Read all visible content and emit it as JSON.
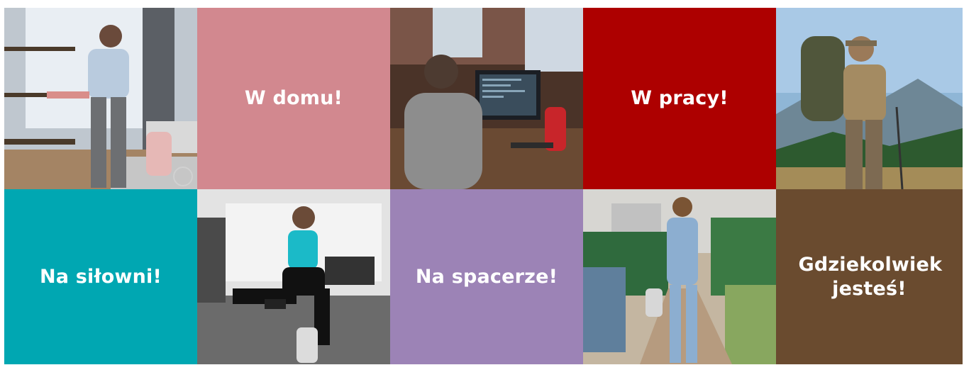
{
  "tiles": {
    "home_label": "W domu!",
    "work_label": "W pracy!",
    "gym_label": "Na siłowni!",
    "walk_label": "Na spacerze!",
    "anywhere_label_line1": "Gdziekolwiek",
    "anywhere_label_line2": "jesteś!"
  },
  "photos": {
    "home_scene": "woman-cleaning-home-with-bottle",
    "office_scene": "developer-at-computer-with-bottle",
    "hiking_scene": "hiker-on-mountain-trail",
    "gym_scene": "woman-lunging-with-dumbbells-and-bottle",
    "park_scene": "woman-walking-in-park-with-bottle"
  },
  "colors": {
    "home": "#d2888f",
    "work": "#ad0000",
    "gym": "#00a7b2",
    "walk": "#9c83b6",
    "anywhere": "#6a4b2f"
  }
}
